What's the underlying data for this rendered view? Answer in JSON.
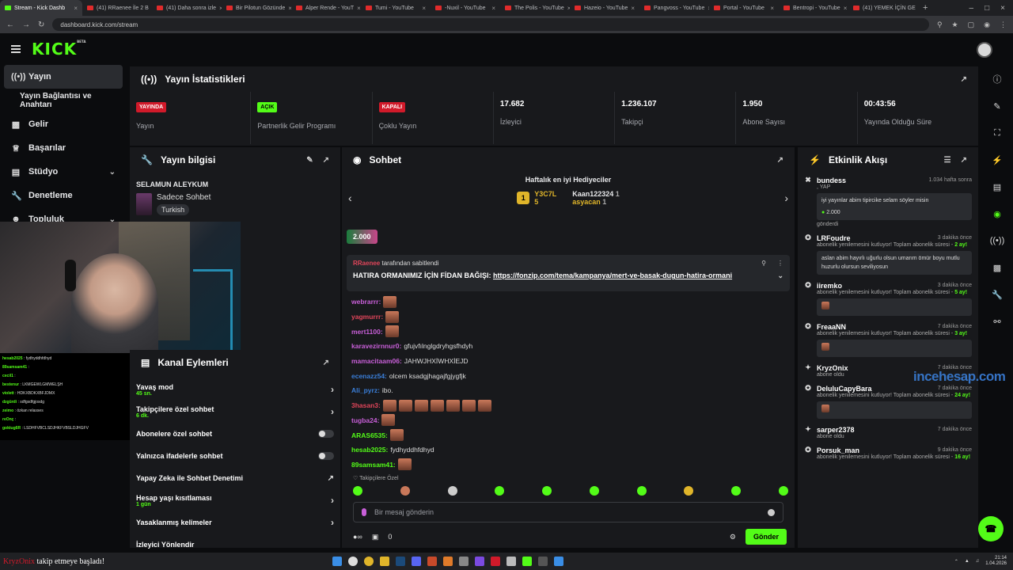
{
  "browser": {
    "tabs": [
      {
        "title": "Stream - Kick Dashb",
        "active": true
      },
      {
        "title": "(41) RRaenee İle 2 B"
      },
      {
        "title": "(41) Daha sonra izle"
      },
      {
        "title": "Bir Pilotun Gözünde"
      },
      {
        "title": "Alper Rende - YouT"
      },
      {
        "title": "Tumi - YouTube"
      },
      {
        "title": "-Nuxil - YouTube"
      },
      {
        "title": "The Polis - YouTube"
      },
      {
        "title": "Hazeio - YouTube"
      },
      {
        "title": "Pangvoss - YouTube"
      },
      {
        "title": "Portal - YouTube"
      },
      {
        "title": "Bentropi - YouTube"
      },
      {
        "title": "(41) YEMEK İÇİN GE"
      }
    ],
    "url": "dashboard.kick.com/stream"
  },
  "header": {
    "logo": "KICK",
    "beta": "BETA"
  },
  "sidebar": {
    "items": [
      {
        "label": "Yayın",
        "icon": "broadcast-icon"
      },
      {
        "label": "Yayın Bağlantısı ve Anahtarı",
        "icon": ""
      },
      {
        "label": "Gelir",
        "icon": "chart-icon"
      },
      {
        "label": "Başarılar",
        "icon": "trophy-icon"
      },
      {
        "label": "Stüdyo",
        "icon": "studio-icon"
      },
      {
        "label": "Denetleme",
        "icon": "wrench-icon"
      },
      {
        "label": "Topluluk",
        "icon": "community-icon"
      }
    ]
  },
  "stats": {
    "title": "Yayın İstatistikleri",
    "cells": [
      {
        "badge": "YAYINDA",
        "badge_color": "#d11a2a",
        "label": "Yayın"
      },
      {
        "badge": "AÇIK",
        "badge_color": "#53fc18",
        "label": "Partnerlik Gelir Programı"
      },
      {
        "badge": "KAPALI",
        "badge_color": "#d11a2a",
        "label": "Çoklu Yayın"
      },
      {
        "value": "17.682",
        "label": "İzleyici"
      },
      {
        "value": "1.236.107",
        "label": "Takipçi"
      },
      {
        "value": "1.950",
        "label": "Abone Sayısı"
      },
      {
        "value": "00:43:56",
        "label": "Yayında Olduğu Süre"
      }
    ]
  },
  "stream_info": {
    "title": "Yayın bilgisi",
    "stream_title": "SELAMUN ALEYKUM",
    "category": "Sadece Sohbet",
    "tag": "Turkish"
  },
  "overlay_chat": [
    {
      "user": "hesab2025",
      "text": "fydhyddhfdhyd"
    },
    {
      "user": "89samsam41",
      "text": ""
    },
    {
      "user": "cecil1",
      "text": ""
    },
    {
      "user": "bestenur",
      "text": "LKMGEWLGMWELŞH"
    },
    {
      "user": "violett",
      "text": "HDKXBDKXBFJDMX"
    },
    {
      "user": "dzgürdi",
      "text": "sdfgsdfgjosdg"
    },
    {
      "user": "zeimo",
      "text": "özkan relasses"
    },
    {
      "user": "reOnç",
      "text": ""
    },
    {
      "user": "goktug6R",
      "text": "LSDHFVBCLSDJHKFVBSLDJHGFV"
    }
  ],
  "channel_actions": {
    "title": "Kanal Eylemleri",
    "rows": [
      {
        "label": "Yavaş mod",
        "sub": "45 sn.",
        "control": "chevron"
      },
      {
        "label": "Takipçilere özel sohbet",
        "sub": "6 dk.",
        "control": "chevron"
      },
      {
        "label": "Abonelere özel sohbet",
        "sub": "",
        "control": "toggle"
      },
      {
        "label": "Yalnızca ifadelerle sohbet",
        "sub": "",
        "control": "toggle"
      },
      {
        "label": "Yapay Zeka ile Sohbet Denetimi",
        "sub": "",
        "control": "external"
      },
      {
        "label": "Hesap yaşı kısıtlaması",
        "sub": "1 gün",
        "control": "chevron"
      },
      {
        "label": "Yasaklanmış kelimeler",
        "sub": "",
        "control": "chevron"
      },
      {
        "label": "İzleyici Yönlendir",
        "sub": "",
        "control": ""
      }
    ]
  },
  "chat": {
    "title": "Sohbet",
    "gifters_title": "Haftalık en iyi Hediyeciler",
    "top_gifter": {
      "name": "Y3C7L",
      "count": "5"
    },
    "gifter2": {
      "name": "Kaan122324",
      "count": "1"
    },
    "gifter3": {
      "name": "asyacan",
      "count": "1"
    },
    "gift_pill": "2.000",
    "pinned_by_name": "RRaenee",
    "pinned_by_text": "tarafından sabitlendi",
    "pinned_message": "HATIRA ORMANIMIZ İÇİN FİDAN BAĞIŞI:",
    "pinned_link": "https://fonzip.com/tema/kampanya/mert-ve-basak-dugun-hatira-ormani",
    "messages": [
      {
        "user": "webrarrr:",
        "color": "#c85fd8",
        "text": "",
        "emotes": 1
      },
      {
        "user": "yagmurrr:",
        "color": "#e0455a",
        "text": "",
        "emotes": 1
      },
      {
        "user": "mert1100:",
        "color": "#c85fd8",
        "text": "",
        "emotes": 1
      },
      {
        "user": "karavezirnnur0:",
        "color": "#c85fd8",
        "text": "gfujvfılnglgdryhgsfhdyh",
        "emotes": 0
      },
      {
        "user": "mamacitaam06:",
        "color": "#c85fd8",
        "text": "JAHWJHXİWHXİEJD",
        "emotes": 0
      },
      {
        "user": "ecenazz54:",
        "color": "#3a7ed8",
        "text": "olcem ksadgjhagajfgjygfjk",
        "emotes": 0
      },
      {
        "user": "Ali_pyrz:",
        "color": "#3a7ed8",
        "text": "ibo.",
        "emotes": 0
      },
      {
        "user": "3hasan3:",
        "color": "#e0455a",
        "text": "",
        "emotes": 7
      },
      {
        "user": "tugba24:",
        "color": "#c85fd8",
        "text": "",
        "emotes": 1
      },
      {
        "user": "ARAS6535:",
        "color": "#53fc18",
        "text": "",
        "emotes": 1
      },
      {
        "user": "hesab2025:",
        "color": "#53fc18",
        "text": "fydhyddhfdhyd",
        "emotes": 0
      },
      {
        "user": "89samsam41:",
        "color": "#53fc18",
        "text": "",
        "emotes": 1
      }
    ],
    "follower_only": "Takipçilere Özel",
    "input_placeholder": "Bir mesaj gönderin",
    "points": "0",
    "send_label": "Gönder"
  },
  "feed": {
    "title": "Etkinlik Akışı",
    "items": [
      {
        "name": "bundess",
        "ago": "1.034 hafta sonra",
        "sub": ", YAP",
        "box": "iyi yayınlar abim tipircike selam söyler misin",
        "amount": "2.000",
        "after": "gönderdi",
        "icon": "gift-icon"
      },
      {
        "name": "LRFoudre",
        "ago": "3 dakika önce",
        "sub": "abonelik yenilemesini kutluyor! Toplam abonelik süresi - ",
        "months": "2 ay!",
        "box": "aslan abim hayırlı uğurlu olsun umarım ömür boyu mutlu huzurlu olursun seviliyosun",
        "icon": "sub-icon"
      },
      {
        "name": "iiremko",
        "ago": "3 dakika önce",
        "sub": "abonelik yenilemesini kutluyor! Toplam abonelik süresi - ",
        "months": "5 ay!",
        "box": "",
        "icon": "sub-icon"
      },
      {
        "name": "FreaaNN",
        "ago": "7 dakika önce",
        "sub": "abonelik yenilemesini kutluyor! Toplam abonelik süresi - ",
        "months": "3 ay!",
        "box": "",
        "icon": "sub-icon"
      },
      {
        "name": "KryzOnix",
        "ago": "7 dakika önce",
        "sub": "abone oldu",
        "icon": "star-icon"
      },
      {
        "name": "DeluluCapyBara",
        "ago": "7 dakika önce",
        "sub": "abonelik yenilemesini kutluyor! Toplam abonelik süresi - ",
        "months": "24 ay!",
        "box": "",
        "icon": "sub-icon"
      },
      {
        "name": "sarper2378",
        "ago": "7 dakika önce",
        "sub": "abone oldu",
        "icon": "star-icon"
      },
      {
        "name": "Porsuk_man",
        "ago": "9 dakika önce",
        "sub": "abonelik yenilemesini kutluyor! Toplam abonelik süresi - ",
        "months": "16 ay!",
        "icon": "sub-icon"
      }
    ]
  },
  "watermark": "incehesap.com",
  "taskbar": {
    "notice_name": "KryzOnix",
    "notice_text": "takip etmeye başladı!",
    "time": "21:14",
    "date": "1.04.2026"
  }
}
